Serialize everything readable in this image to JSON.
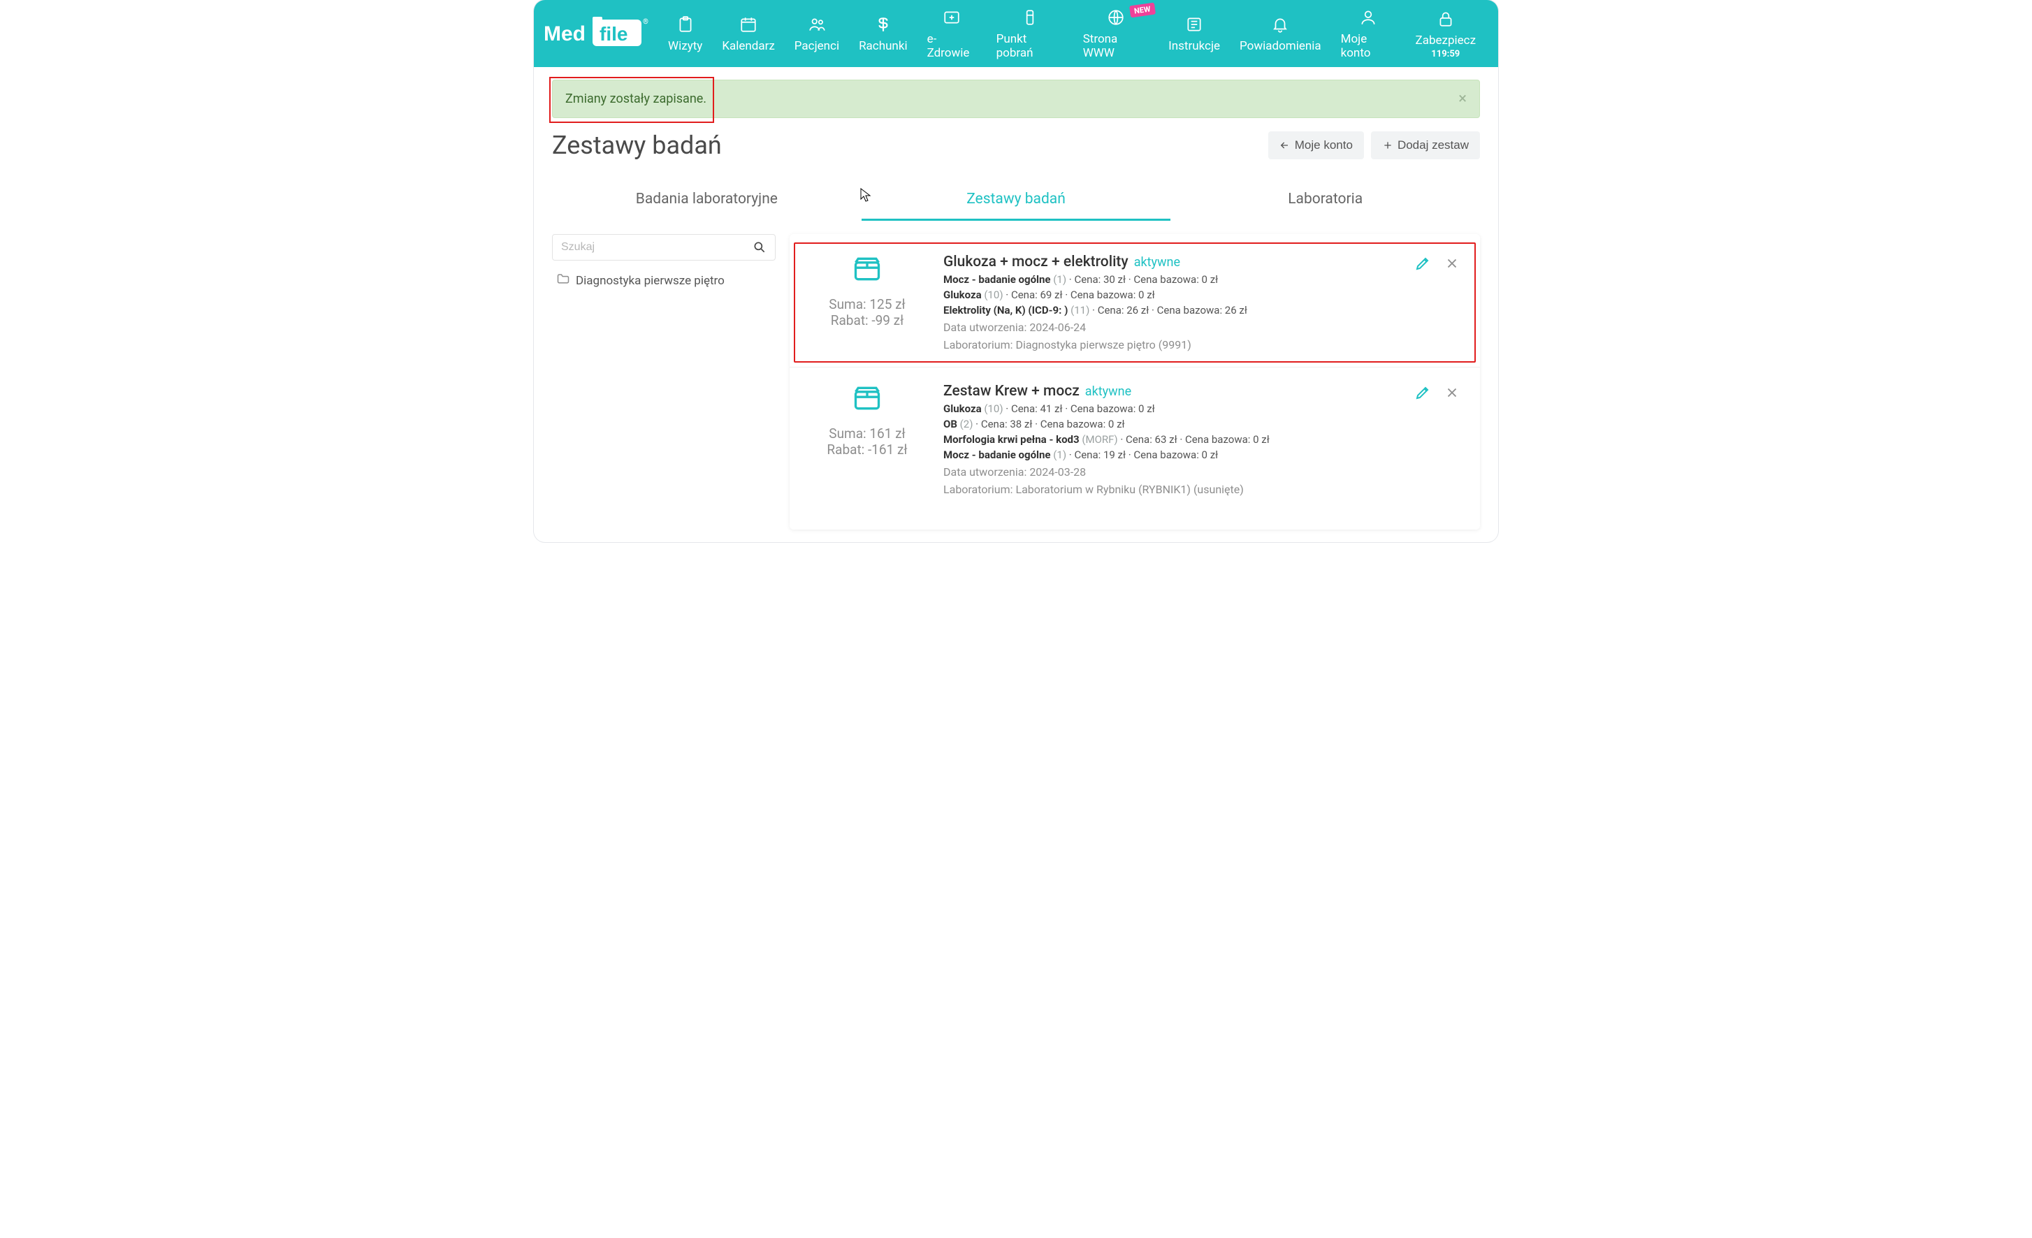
{
  "nav": {
    "items": [
      {
        "label": "Wizyty"
      },
      {
        "label": "Kalendarz"
      },
      {
        "label": "Pacjenci"
      },
      {
        "label": "Rachunki"
      },
      {
        "label": "e-Zdrowie"
      },
      {
        "label": "Punkt pobrań"
      },
      {
        "label": "Strona WWW",
        "badge": "NEW"
      },
      {
        "label": "Instrukcje"
      }
    ],
    "right": [
      {
        "label": "Powiadomienia"
      },
      {
        "label": "Moje konto"
      },
      {
        "label": "Zabezpiecz",
        "sub": "119:59"
      }
    ]
  },
  "alert": {
    "text": "Zmiany zostały zapisane."
  },
  "page": {
    "title": "Zestawy badań",
    "back_btn": "Moje konto",
    "add_btn": "Dodaj zestaw"
  },
  "tabs": {
    "0": "Badania laboratoryjne",
    "1": "Zestawy badań",
    "2": "Laboratoria"
  },
  "search": {
    "placeholder": "Szukaj"
  },
  "folder": {
    "label": "Diagnostyka pierwsze piętro"
  },
  "sets": [
    {
      "title": "Glukoza + mocz + elektrolity",
      "status": "aktywne",
      "sum": "Suma: 125 zł",
      "discount": "Rabat: -99 zł",
      "created_label": "Data utworzenia:",
      "created_value": "2024-06-24",
      "lab_label": "Laboratorium:",
      "lab_value": "Diagnostyka pierwsze piętro (9991)",
      "lines": [
        {
          "name": "Mocz - badanie ogólne",
          "code": "(1)",
          "price": "Cena: 30 zł",
          "base": "Cena bazowa: 0 zł"
        },
        {
          "name": "Glukoza",
          "code": "(10)",
          "price": "Cena: 69 zł",
          "base": "Cena bazowa: 0 zł"
        },
        {
          "name": "Elektrolity (Na, K) (ICD-9: )",
          "code": "(11)",
          "price": "Cena: 26 zł",
          "base": "Cena bazowa: 26 zł"
        }
      ]
    },
    {
      "title": "Zestaw Krew + mocz",
      "status": "aktywne",
      "sum": "Suma: 161 zł",
      "discount": "Rabat: -161 zł",
      "created_label": "Data utworzenia:",
      "created_value": "2024-03-28",
      "lab_label": "Laboratorium:",
      "lab_value": "Laboratorium w Rybniku (RYBNIK1) (usunięte)",
      "lines": [
        {
          "name": "Glukoza",
          "code": "(10)",
          "price": "Cena: 41 zł",
          "base": "Cena bazowa: 0 zł"
        },
        {
          "name": "OB",
          "code": "(2)",
          "price": "Cena: 38 zł",
          "base": "Cena bazowa: 0 zł"
        },
        {
          "name": "Morfologia krwi pełna - kod3",
          "code": "(MORF)",
          "price": "Cena: 63 zł",
          "base": "Cena bazowa: 0 zł"
        },
        {
          "name": "Mocz - badanie ogólne",
          "code": "(1)",
          "price": "Cena: 19 zł",
          "base": "Cena bazowa: 0 zł"
        }
      ]
    }
  ]
}
